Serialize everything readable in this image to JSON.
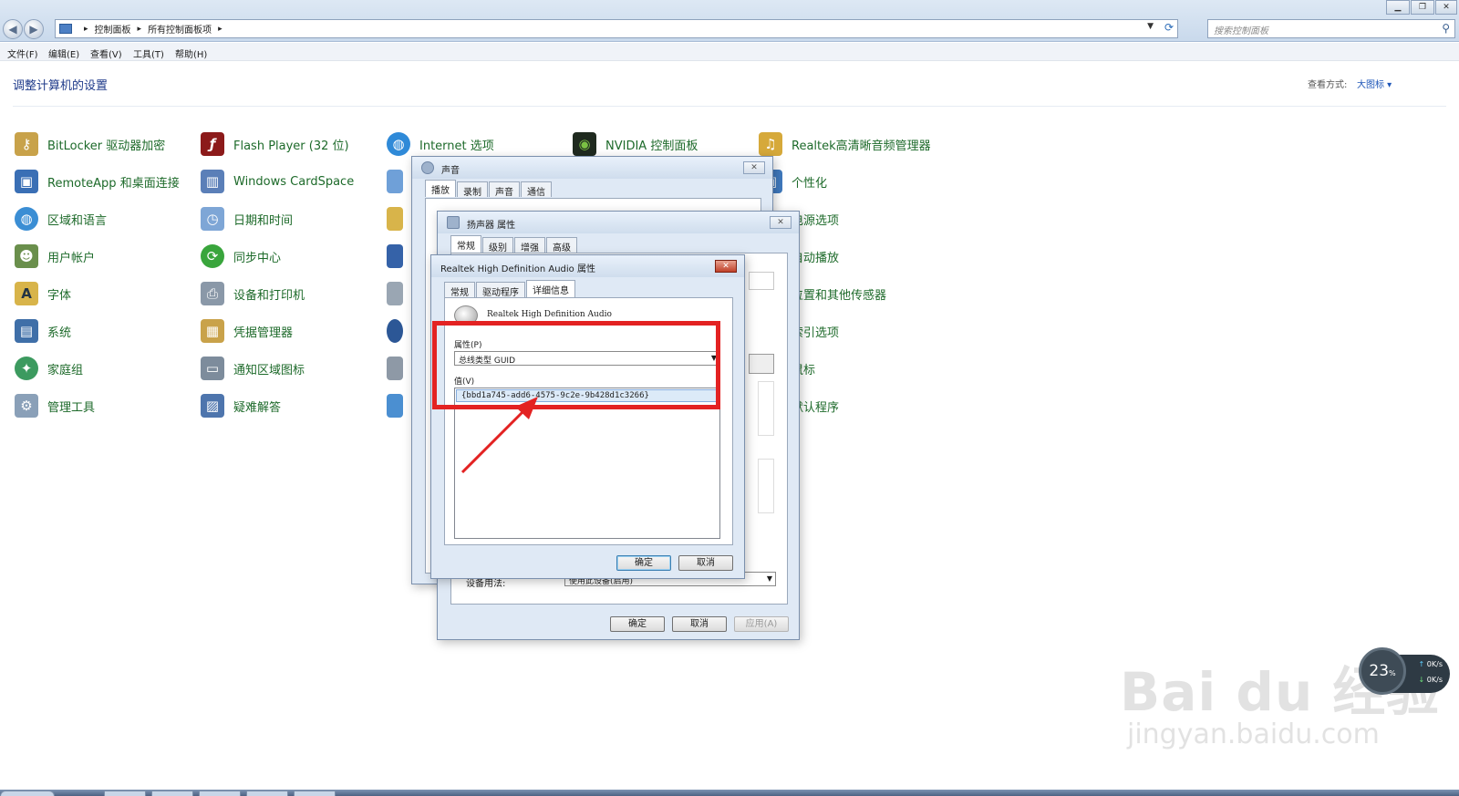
{
  "explorer": {
    "breadcrumb": [
      "控制面板",
      "所有控制面板项"
    ],
    "search_placeholder": "搜索控制面板",
    "menu": [
      "文件(F)",
      "编辑(E)",
      "查看(V)",
      "工具(T)",
      "帮助(H)"
    ],
    "page_title": "调整计算机的设置",
    "view_label": "查看方式:",
    "view_value": "大图标 ▾"
  },
  "control_panel_items": {
    "col1": [
      "BitLocker 驱动器加密",
      "RemoteApp 和桌面连接",
      "区域和语言",
      "用户帐户",
      "字体",
      "系统",
      "家庭组",
      "管理工具"
    ],
    "col2": [
      "Flash Player (32 位)",
      "Windows CardSpace",
      "日期和时间",
      "同步中心",
      "设备和打印机",
      "凭据管理器",
      "通知区域图标",
      "疑难解答"
    ],
    "col3": [
      "Internet 选项"
    ],
    "col4": [
      "NVIDIA 控制面板"
    ],
    "col5": [
      "Realtek高清晰音频管理器",
      "个性化",
      "电源选项",
      "自动播放",
      "位置和其他传感器",
      "索引选项",
      "鼠标",
      "默认程序"
    ]
  },
  "sound_dialog": {
    "title": "声音",
    "tabs": [
      "播放",
      "录制",
      "声音",
      "通信"
    ]
  },
  "speaker_dialog": {
    "title": "扬声器 属性",
    "tabs": [
      "常规",
      "级别",
      "增强",
      "高级"
    ],
    "device_usage_label": "设备用法:",
    "device_usage_value": "使用此设备(启用)",
    "ok": "确定",
    "cancel": "取消",
    "apply": "应用(A)"
  },
  "realtek_dialog": {
    "title": "Realtek High Definition Audio 属性",
    "tabs": [
      "常规",
      "驱动程序",
      "详细信息"
    ],
    "device_name": "Realtek High Definition Audio",
    "property_label": "属性(P)",
    "property_value": "总线类型 GUID",
    "value_label": "值(V)",
    "value_item": "{bbd1a745-add6-4575-9c2e-9b428d1c3266}",
    "ok": "确定",
    "cancel": "取消"
  },
  "net_widget": {
    "percent": "23",
    "percent_unit": "%",
    "up": "0K/s",
    "down": "0K/s"
  },
  "watermark": {
    "line1": "Bai du 经验",
    "line2": "jingyan.baidu.com"
  },
  "colors": {
    "link_green": "#1d6a2a",
    "highlight_red": "#e32222",
    "arrow_red": "#e32222"
  }
}
